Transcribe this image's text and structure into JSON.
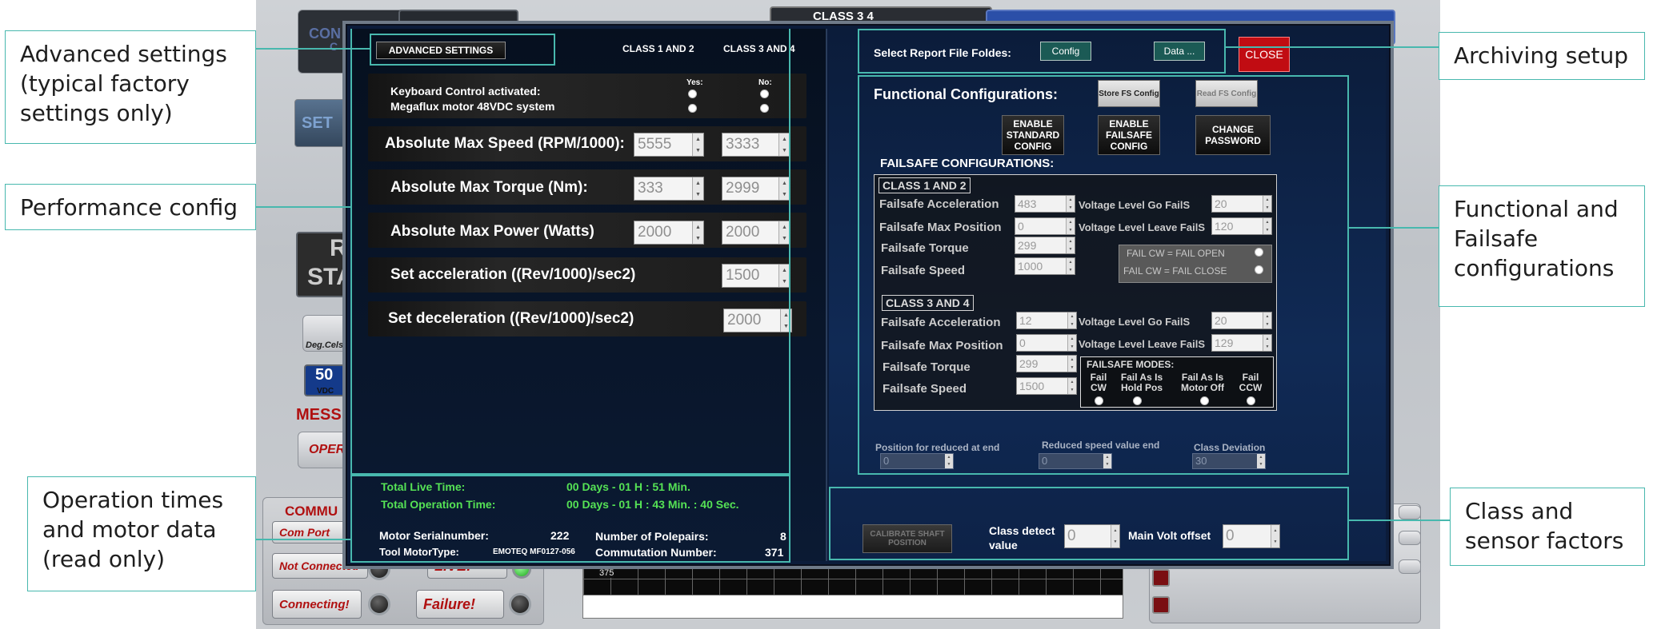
{
  "background_app": {
    "title_left": "CON",
    "title_left2": "C",
    "class_tab": "CLASS 3  4",
    "set_label": "SET",
    "r_label": "R",
    "sta_label": "STA",
    "deg_label": "Deg.Cels.",
    "volt_value": "50",
    "volt_unit": "VDC",
    "mess_label": "MESS",
    "oper_label": "OPER",
    "comm_label": "COMMU",
    "com_port_label": "Com Port",
    "not_connected_label": "Not Connected",
    "live_label": "LIVE!",
    "connecting_label": "Connecting!",
    "failure_label": "Failure!",
    "chart_tick": "375"
  },
  "left_pane": {
    "advanced_settings_button": "ADVANCED SETTINGS",
    "header_class12": "CLASS 1 AND 2",
    "header_class34": "CLASS 3 AND 4",
    "yes_label": "Yes:",
    "no_label": "No:",
    "keyboard_control_label": "Keyboard Control activated:",
    "megaflux_label": "Megaflux motor 48VDC system",
    "rows": [
      {
        "label": "Absolute Max Speed (RPM/1000):",
        "value_class12": "5555",
        "value_class34": "3333"
      },
      {
        "label": "Absolute Max Torque (Nm):",
        "value_class12": "333",
        "value_class34": "2999"
      },
      {
        "label": "Absolute Max Power (Watts)",
        "value_class12": "2000",
        "value_class34": "2000"
      },
      {
        "label": "Set acceleration ((Rev/1000)/sec2)",
        "value_class34": "1500"
      },
      {
        "label": "Set deceleration ((Rev/1000)/sec2)",
        "value_class34": "2000"
      }
    ],
    "total_live_time_label": "Total Live Time:",
    "total_live_time_value": "00 Days - 01 H : 51 Min.",
    "total_operation_time_label": "Total Operation Time:",
    "total_operation_time_value": "00 Days - 01 H : 43 Min. : 40 Sec.",
    "motor_serial_label": "Motor Serialnumber:",
    "motor_serial_value": "222",
    "polepairs_label": "Number of Polepairs:",
    "polepairs_value": "8",
    "tool_motor_type_label": "Tool MotorType:",
    "tool_motor_type_value": "EMOTEQ MF0127-056",
    "commutation_label": "Commutation Number:",
    "commutation_value": "371"
  },
  "right_pane": {
    "select_report_label": "Select Report File Foldes:",
    "config_button": "Config",
    "data_button": "Data ...",
    "close_button": "CLOSE",
    "functional_configurations_label": "Functional Configurations:",
    "store_fs_button": "Store FS Config",
    "read_fs_button": "Read FS Config",
    "enable_standard_button": "ENABLE STANDARD CONFIG",
    "enable_failsafe_button": "ENABLE FAILSAFE CONFIG",
    "change_password_button": "CHANGE PASSWORD",
    "failsafe_configurations_label": "FAILSAFE CONFIGURATIONS:",
    "class12": {
      "title": "CLASS 1 AND 2",
      "acceleration_label": "Failsafe Acceleration",
      "acceleration_value": "483",
      "max_position_label": "Failsafe Max Position",
      "max_position_value": "0",
      "torque_label": "Failsafe Torque",
      "torque_value": "299",
      "speed_label": "Failsafe Speed",
      "speed_value": "1000",
      "voltage_go_label": "Voltage Level Go FailS",
      "voltage_go_value": "20",
      "voltage_leave_label": "Voltage Level Leave FailS",
      "voltage_leave_value": "120",
      "fail_open_label": "FAIL CW = FAIL OPEN",
      "fail_close_label": "FAIL CW = FAIL CLOSE"
    },
    "class34": {
      "title": "CLASS 3 AND 4",
      "acceleration_label": "Failsafe Acceleration",
      "acceleration_value": "12",
      "max_position_label": "Failsafe Max Position",
      "max_position_value": "0",
      "torque_label": "Failsafe Torque",
      "torque_value": "299",
      "speed_label": "Failsafe Speed",
      "speed_value": "1500",
      "voltage_go_label": "Voltage Level Go FailS",
      "voltage_go_value": "20",
      "voltage_leave_label": "Voltage Level Leave FailS",
      "voltage_leave_value": "129"
    },
    "failsafe_modes_label": "FAILSAFE MODES:",
    "modes": [
      {
        "line1": "Fail",
        "line2": "CW"
      },
      {
        "line1": "Fail As Is",
        "line2": "Hold Pos"
      },
      {
        "line1": "Fail As Is",
        "line2": "Motor Off"
      },
      {
        "line1": "Fail",
        "line2": "CCW"
      }
    ],
    "position_reduced_label": "Position for reduced at end",
    "position_reduced_value": "0",
    "reduced_speed_label": "Reduced speed value end",
    "reduced_speed_value": "0",
    "class_deviation_label": "Class Deviation",
    "class_deviation_value": "30",
    "calibrate_button": "CALIBRATE SHAFT POSITION",
    "class_detect_label_line1": "Class detect",
    "class_detect_label_line2": "value",
    "class_detect_value": "0",
    "main_volt_label": "Main Volt offset",
    "main_volt_value": "0"
  },
  "annotations": {
    "advanced_settings": "Advanced settings (typical factory settings only)",
    "performance_config": "Performance config",
    "operation_times": "Operation times and motor data (read only)",
    "archiving_setup": "Archiving setup",
    "functional_failsafe": "Functional and Failsafe configurations",
    "class_sensor": "Class and sensor factors"
  },
  "colors": {
    "annotation_teal": "#48b8ae",
    "dialog_navy": "#0c1c3a",
    "close_red": "#c10c12",
    "time_green": "#55e255"
  }
}
